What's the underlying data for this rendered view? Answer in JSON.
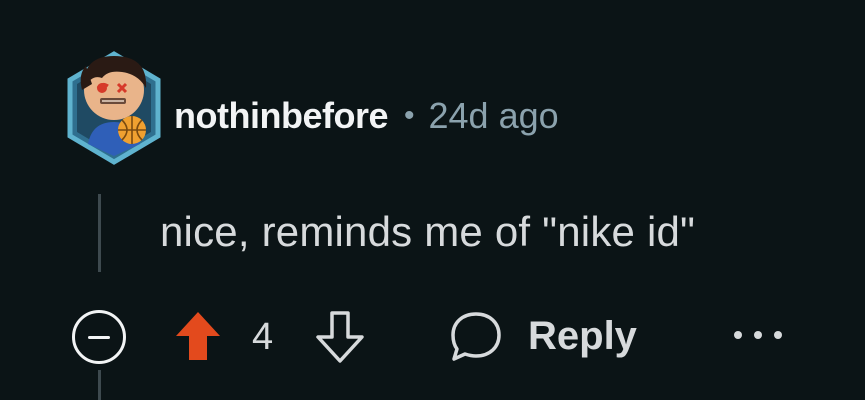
{
  "comment": {
    "author": "nothinbefore",
    "separator": "•",
    "age": "24d ago",
    "text": "nice, reminds me of \"nike id\"",
    "score": "4"
  },
  "actions": {
    "reply_label": "Reply"
  },
  "icons": {
    "avatar": "user-avatar-basketball",
    "collapse": "minus-circle-icon",
    "upvote": "upvote-arrow-icon",
    "downvote": "downvote-arrow-icon",
    "reply": "speech-bubble-icon",
    "more": "more-dots-icon"
  },
  "colors": {
    "background": "#0b1416",
    "upvote_active": "#e34a1d",
    "text": "#d7dadc",
    "meta": "#8ba2ad",
    "thread_line": "#3e4a4f"
  }
}
